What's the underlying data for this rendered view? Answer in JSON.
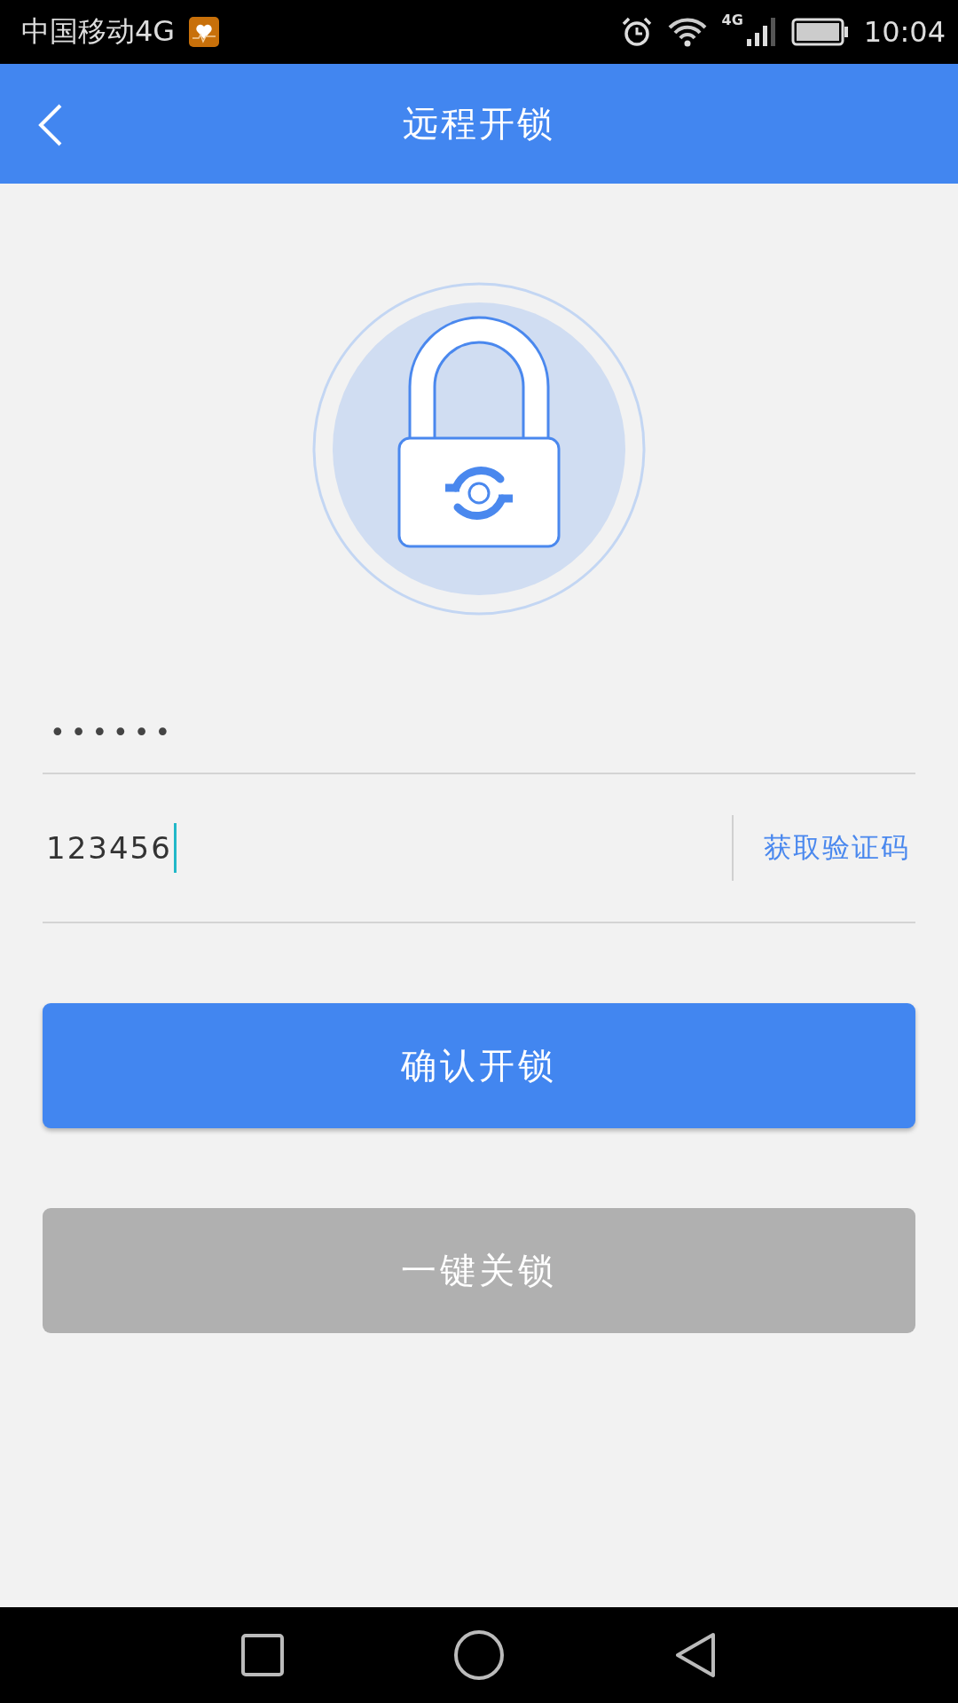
{
  "status_bar": {
    "carrier": "中国移动4G",
    "network": "4G",
    "time": "10:04"
  },
  "app_bar": {
    "title": "远程开锁"
  },
  "password_field": {
    "value": "••••••"
  },
  "code_field": {
    "value": "123456",
    "focused": true,
    "action": "获取验证码"
  },
  "buttons": [
    {
      "label": "确认开锁",
      "disabled": false
    },
    {
      "label": "一键关锁",
      "disabled": true
    }
  ]
}
